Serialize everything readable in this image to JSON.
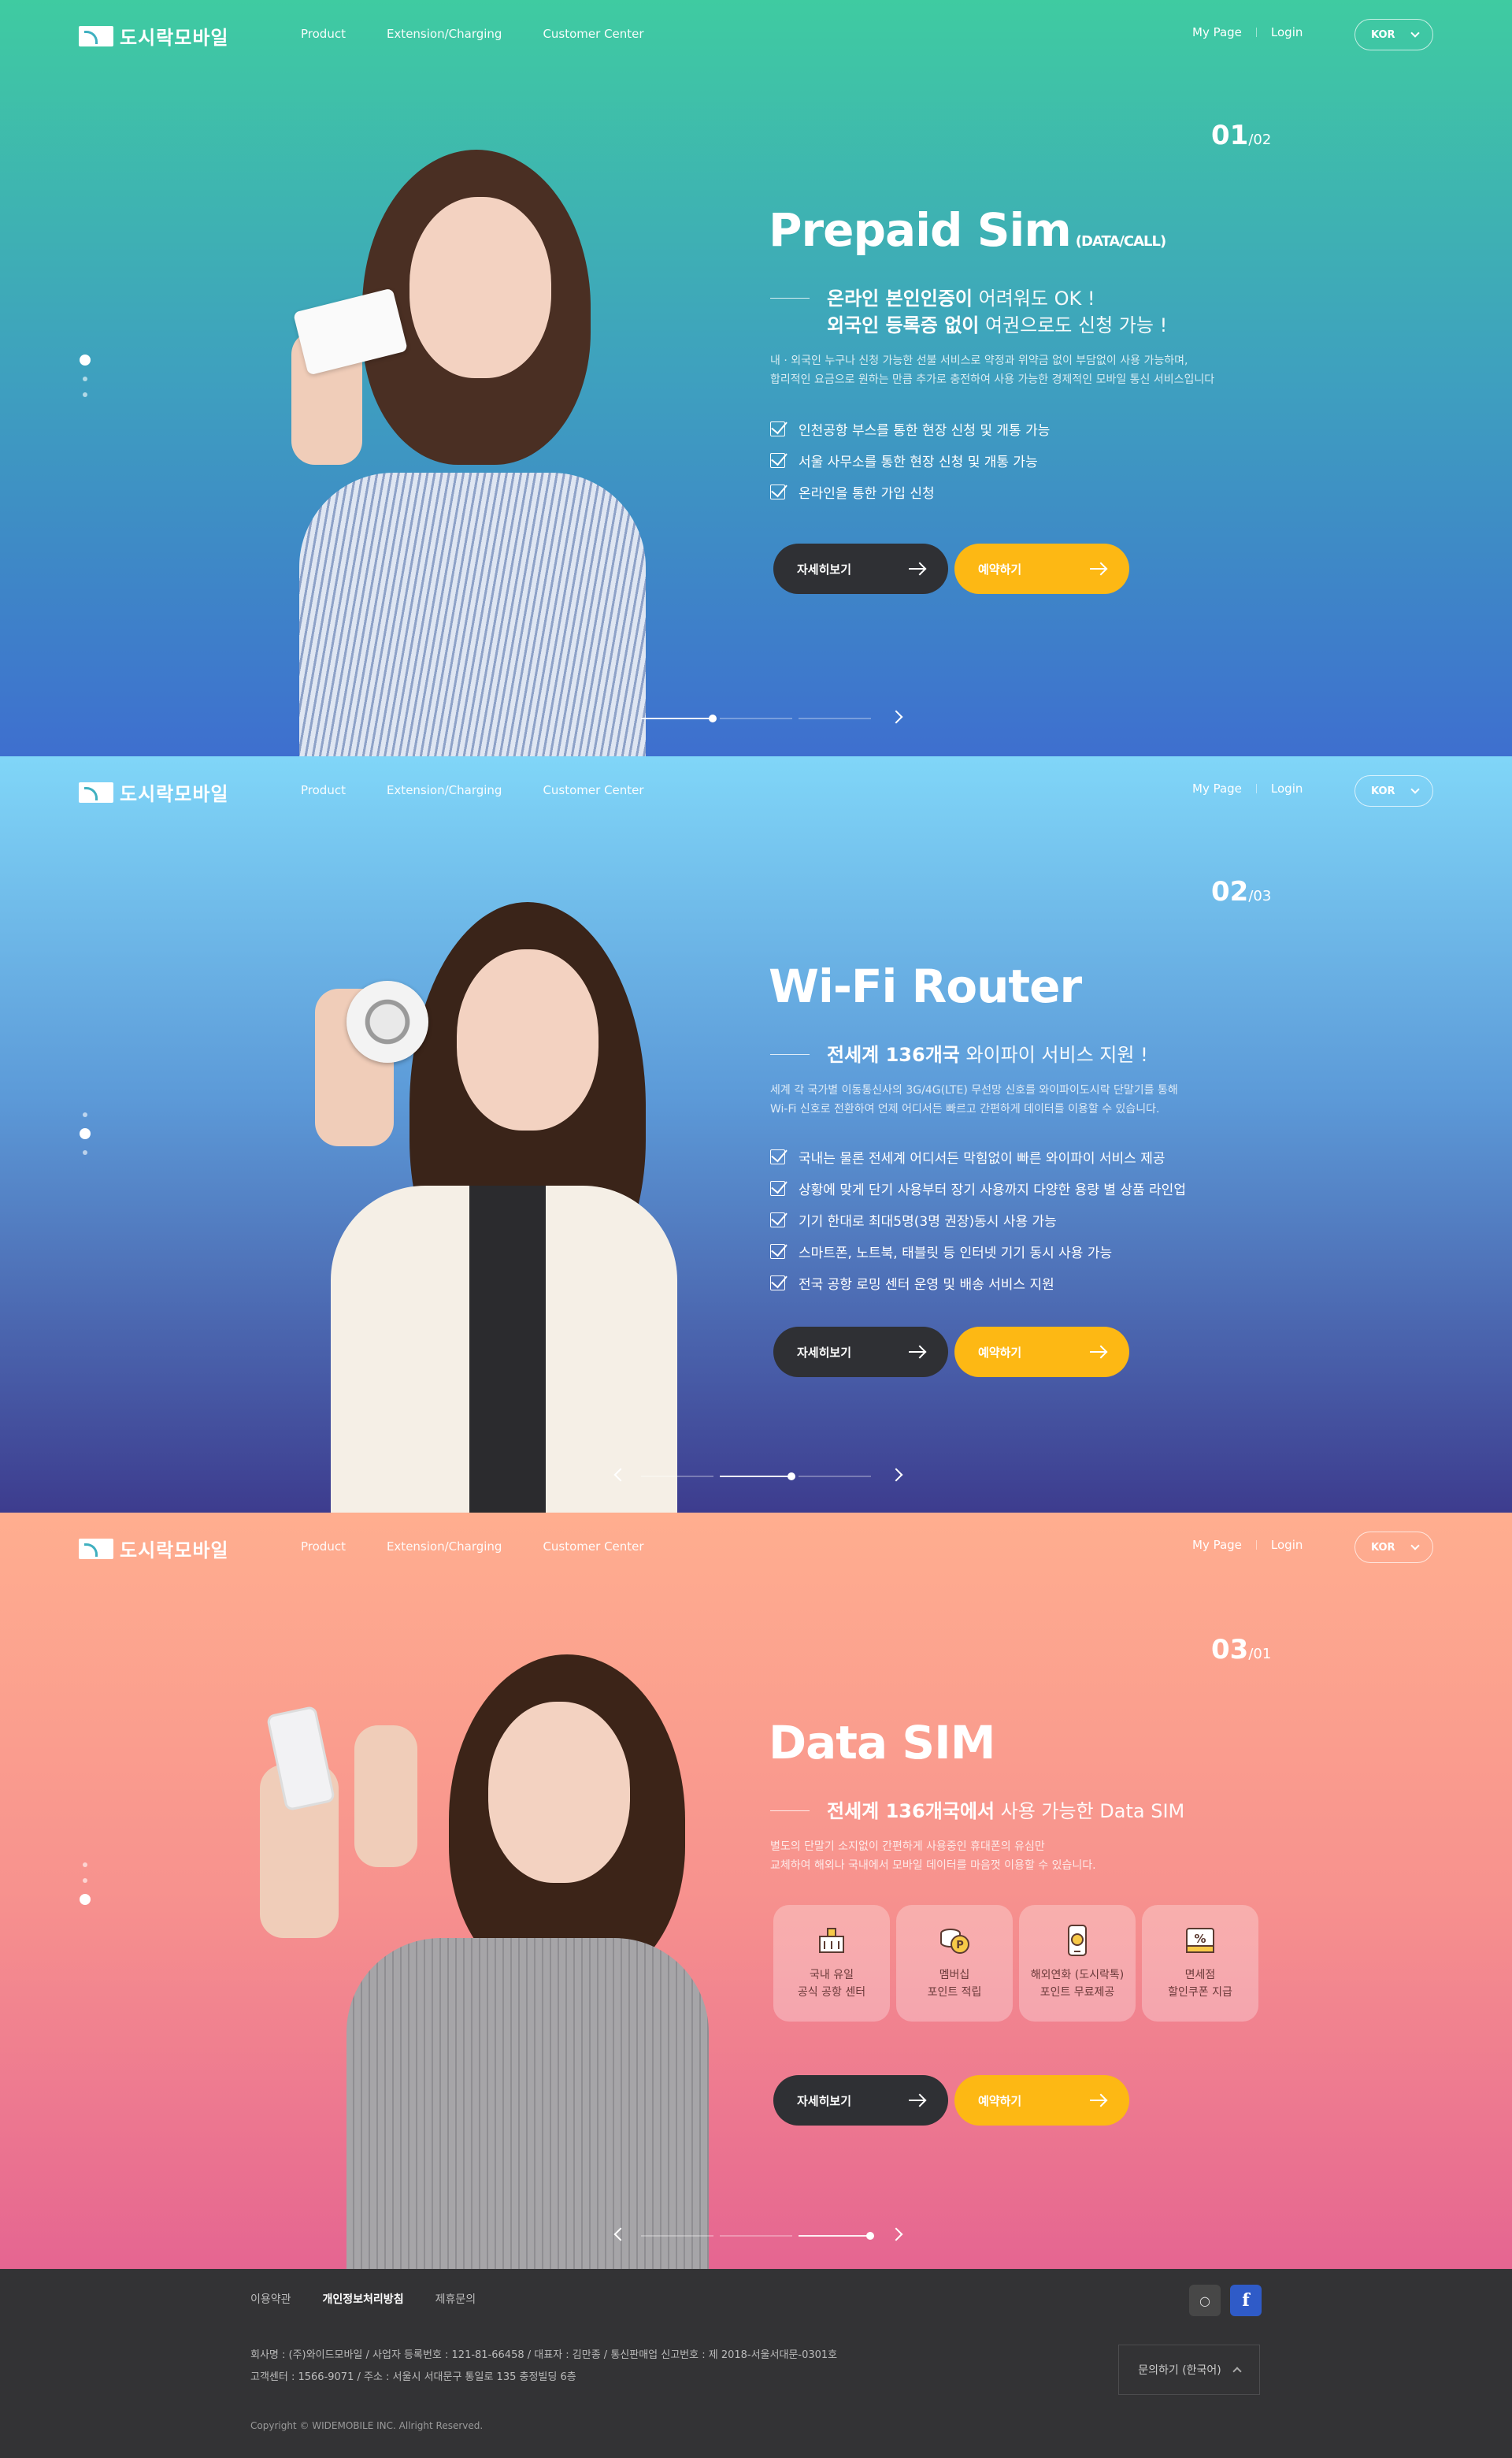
{
  "header": {
    "logo_text": "도시락모바일",
    "nav": [
      "Product",
      "Extension/Charging",
      "Customer Center"
    ],
    "mypage": "My Page",
    "login": "Login",
    "lang": "KOR"
  },
  "slides": [
    {
      "counter_current": "01",
      "counter_total": "/02",
      "title": "Prepaid Sim",
      "title_sub": "(DATA/CALL)",
      "lead": [
        {
          "bold": "온라인 본인인증이",
          "light": " 어려워도 OK !"
        },
        {
          "bold": "외국인 등록증 없이",
          "light": " 여권으로도 신청 가능 !"
        }
      ],
      "desc": [
        "내 · 외국인 누구나 신청 가능한 선불 서비스로 약정과 위약금 없이 부담없이 사용 가능하며,",
        "합리적인 요금으로 원하는 만큼 추가로 충전하여 사용 가능한 경제적인 모바일 통신 서비스입니다"
      ],
      "checks": [
        "인천공항 부스를 통한 현장 신청 및 개통 가능",
        "서울 사무소를 통한 현장 신청 및 개통 가능",
        "온라인을 통한 가입 신청"
      ],
      "btn_detail": "자세히보기",
      "btn_reserve": "예약하기"
    },
    {
      "counter_current": "02",
      "counter_total": "/03",
      "title": "Wi-Fi Router",
      "title_sub": "",
      "lead": [
        {
          "bold": "전세계 136개국",
          "light": " 와이파이 서비스 지원 !"
        }
      ],
      "desc": [
        "세계 각 국가별 이동통신사의 3G/4G(LTE) 무선망 신호를 와이파이도시락 단말기를 통해",
        "Wi-Fi 신호로 전환하여 언제 어디서든 빠르고 간편하게 데이터를 이용할 수 있습니다."
      ],
      "checks": [
        "국내는 물론 전세계 어디서든 막힘없이 빠른 와이파이 서비스 제공",
        "상황에 맞게 단기 사용부터 장기 사용까지 다양한 용량 별 상품 라인업",
        "기기 한대로 최대5명(3명 권장)동시 사용 가능",
        "스마트폰, 노트북, 태블릿 등 인터넷 기기 동시 사용 가능",
        "전국 공항 로밍 센터 운영 및 배송 서비스 지원"
      ],
      "btn_detail": "자세히보기",
      "btn_reserve": "예약하기"
    },
    {
      "counter_current": "03",
      "counter_total": "/01",
      "title": "Data SIM",
      "title_sub": "",
      "lead": [
        {
          "bold": "전세계 136개국에서",
          "light": " 사용 가능한 Data SIM"
        }
      ],
      "desc": [
        "별도의 단말기 소지없이 간편하게 사용중인 휴대폰의 유심만",
        "교체하여 해외나 국내에서 모바일 데이터를 마음껏 이용할 수 있습니다."
      ],
      "features": [
        {
          "l1": "국내 유일",
          "l2": "공식 공항 센터",
          "icon": "airport-building-icon"
        },
        {
          "l1": "멤버십",
          "l2": "포인트 적립",
          "icon": "coin-point-icon"
        },
        {
          "l1": "해외연화 (도시락톡)",
          "l2": "포인트 무료제공",
          "icon": "phone-call-icon"
        },
        {
          "l1": "면세점",
          "l2": "할인쿠폰 지급",
          "icon": "discount-coupon-icon"
        }
      ],
      "btn_detail": "자세히보기",
      "btn_reserve": "예약하기"
    }
  ],
  "footer": {
    "links": [
      "이용약관",
      "개인정보처리방침",
      "제휴문의"
    ],
    "info_line1": "회사명 : (주)와이드모바일  /  사업자 등록번호 : 121-81-66458  /  대표자 : 김만종  /  통신판매업 신고번호 : 제 2018-서울서대문-0301호",
    "info_line2": "고객센터 : 1566-9071  /  주소 : 서울시 서대문구 통일로 135 충정빌딩 6층",
    "copyright": "Copyright © WIDEMOBILE INC. Allright Reserved.",
    "inquiry": "문의하기 (한국어)",
    "facebook": "f"
  },
  "colors": {
    "yellow": "#fdb814",
    "dark_button": "#2f3034",
    "footer_bg": "#333335"
  }
}
